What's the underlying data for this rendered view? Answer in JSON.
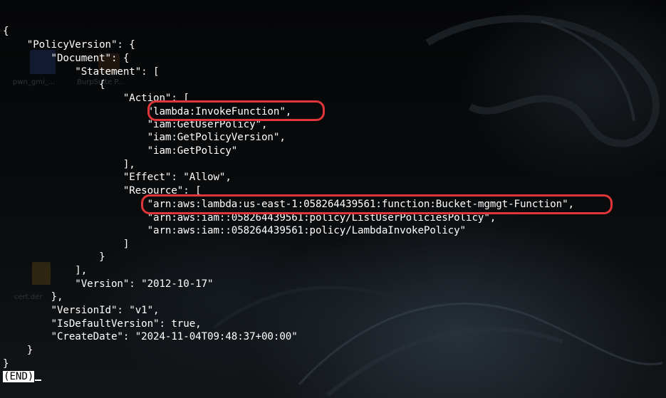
{
  "desktop": {
    "icons": [
      {
        "label": "pwn_gmi_...",
        "icon": "file-icon"
      },
      {
        "label": "BurpSuite P...",
        "icon": "app-icon"
      },
      {
        "label": "cert.der",
        "icon": "certificate-file-icon"
      }
    ]
  },
  "terminal": {
    "lines": [
      "{",
      "    \"PolicyVersion\": {",
      "        \"Document\": {",
      "            \"Statement\": [",
      "                {",
      "                    \"Action\": [",
      "                        \"lambda:InvokeFunction\",",
      "                        \"iam:GetUserPolicy\",",
      "                        \"iam:GetPolicyVersion\",",
      "                        \"iam:GetPolicy\"",
      "                    ],",
      "                    \"Effect\": \"Allow\",",
      "                    \"Resource\": [",
      "                        \"arn:aws:lambda:us-east-1:058264439561:function:Bucket-mgmgt-Function\",",
      "                        \"arn:aws:iam::058264439561:policy/ListUserPoliciesPolicy\",",
      "                        \"arn:aws:iam::058264439561:policy/LambdaInvokePolicy\"",
      "                    ]",
      "                }",
      "            ],",
      "            \"Version\": \"2012-10-17\"",
      "        },",
      "        \"VersionId\": \"v1\",",
      "        \"IsDefaultVersion\": true,",
      "        \"CreateDate\": \"2024-11-04T09:48:37+00:00\"",
      "    }",
      "}"
    ],
    "end_marker": "(END)"
  },
  "annotations": {
    "color": "#e0363a",
    "highlighted": [
      "\"lambda:InvokeFunction\",",
      "\"arn:aws:lambda:us-east-1:058264439561:function:Bucket-mgmgt-Function\","
    ]
  }
}
